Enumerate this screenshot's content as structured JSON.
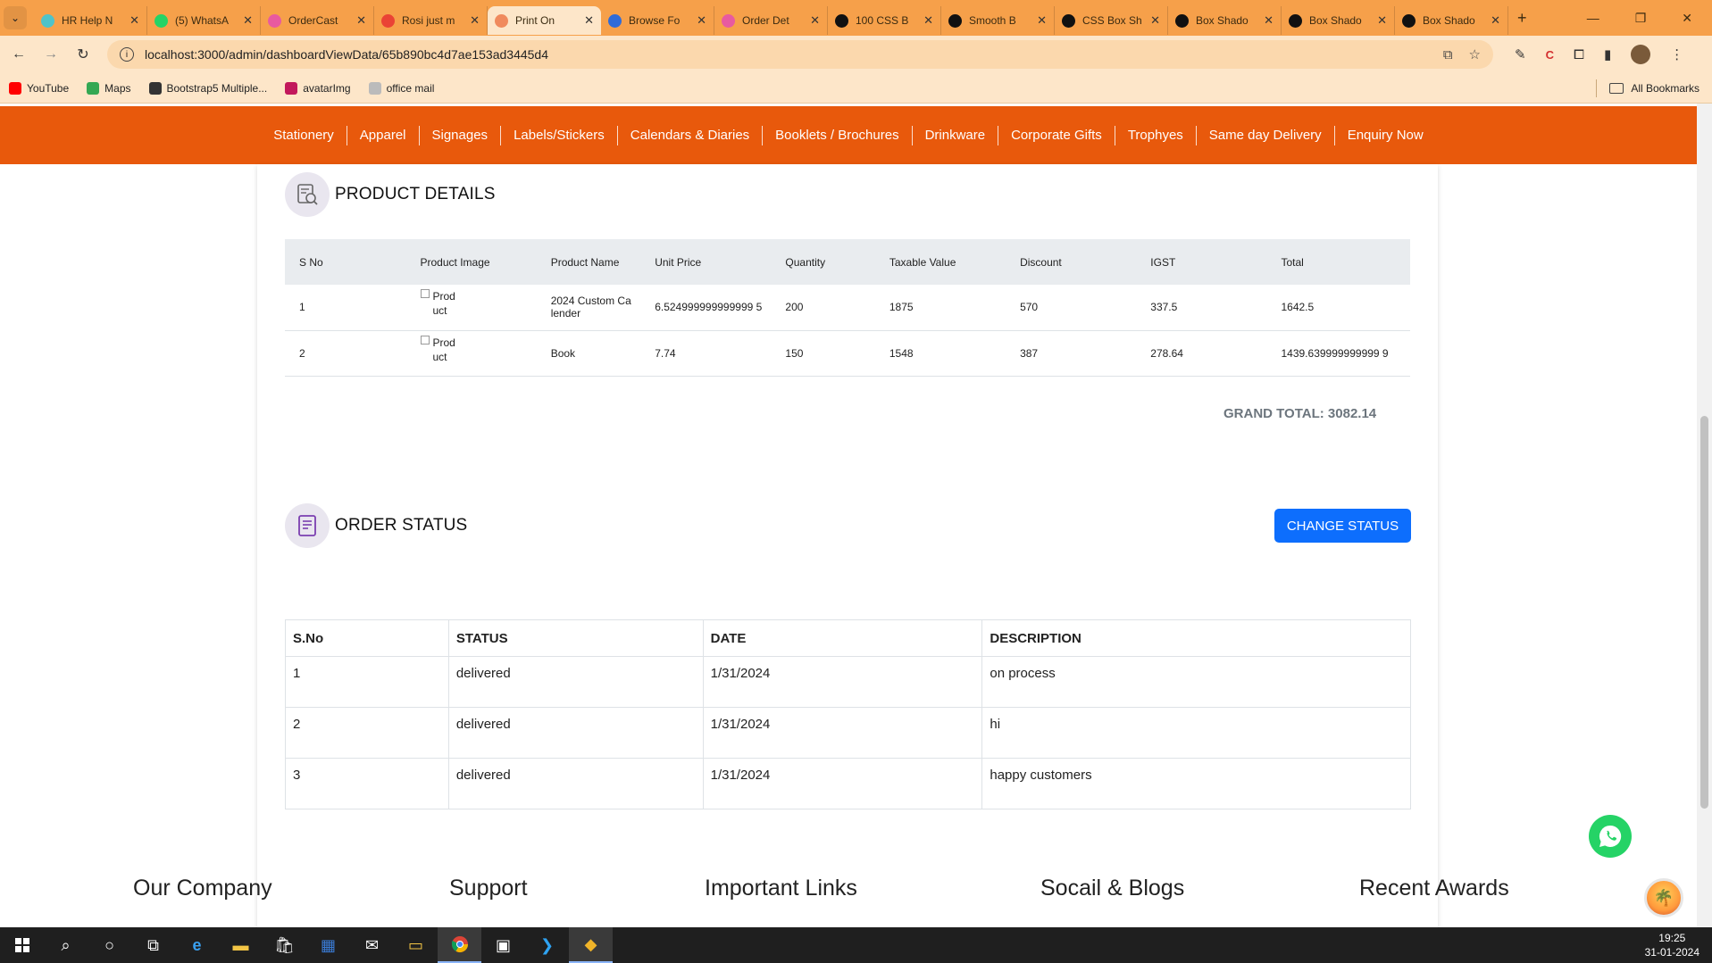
{
  "browser": {
    "tabs": [
      {
        "label": "HR Help N",
        "fav_color": "#4fc3c9",
        "active": false
      },
      {
        "label": "(5) WhatsA",
        "fav_color": "#25d366",
        "active": false
      },
      {
        "label": "OrderCast",
        "fav_color": "#e85aa0",
        "active": false
      },
      {
        "label": "Rosi just m",
        "fav_color": "#ea4335",
        "active": false
      },
      {
        "label": "Print On",
        "fav_color": "#f08a5d",
        "active": true
      },
      {
        "label": "Browse Fo",
        "fav_color": "#2f6bd8",
        "active": false
      },
      {
        "label": "Order Det",
        "fav_color": "#e85aa0",
        "active": false
      },
      {
        "label": "100 CSS B",
        "fav_color": "#111111",
        "active": false
      },
      {
        "label": "Smooth B",
        "fav_color": "#111111",
        "active": false
      },
      {
        "label": "CSS Box Sh",
        "fav_color": "#111111",
        "active": false
      },
      {
        "label": "Box Shado",
        "fav_color": "#111111",
        "active": false
      },
      {
        "label": "Box Shado",
        "fav_color": "#111111",
        "active": false
      },
      {
        "label": "Box Shado",
        "fav_color": "#111111",
        "active": false
      }
    ],
    "url": "localhost:3000/admin/dashboardViewData/65b890bc4d7ae153ad3445d4",
    "bookmarks": [
      {
        "label": "YouTube",
        "color": "#ff0000"
      },
      {
        "label": "Maps",
        "color": "#34a853"
      },
      {
        "label": "Bootstrap5 Multiple...",
        "color": "#333333"
      },
      {
        "label": "avatarImg",
        "color": "#c2185b"
      },
      {
        "label": "office mail",
        "color": "#bbbbbb"
      }
    ],
    "all_bookmarks": "All Bookmarks"
  },
  "site_nav": [
    "Stationery",
    "Apparel",
    "Signages",
    "Labels/Stickers",
    "Calendars & Diaries",
    "Booklets / Brochures",
    "Drinkware",
    "Corporate Gifts",
    "Trophyes",
    "Same day Delivery",
    "Enquiry Now"
  ],
  "product_details": {
    "title": "PRODUCT DETAILS",
    "headers": [
      "S No",
      "Product Image",
      "Product Name",
      "Unit Price",
      "Quantity",
      "Taxable Value",
      "Discount",
      "IGST",
      "Total"
    ],
    "rows": [
      {
        "sno": "1",
        "img_alt": "Product",
        "name": "2024 Custom Calender",
        "unit_price": "6.524999999999999 5",
        "quantity": "200",
        "taxable": "1875",
        "discount": "570",
        "igst": "337.5",
        "total": "1642.5"
      },
      {
        "sno": "2",
        "img_alt": "Product",
        "name": "Book",
        "unit_price": "7.74",
        "quantity": "150",
        "taxable": "1548",
        "discount": "387",
        "igst": "278.64",
        "total": "1439.639999999999 9"
      }
    ],
    "grand_total": "GRAND TOTAL: 3082.14"
  },
  "order_status": {
    "title": "ORDER STATUS",
    "change_button": "CHANGE STATUS",
    "headers": [
      "S.No",
      "STATUS",
      "DATE",
      "DESCRIPTION"
    ],
    "rows": [
      {
        "sno": "1",
        "status": "delivered",
        "date": "1/31/2024",
        "description": "on process"
      },
      {
        "sno": "2",
        "status": "delivered",
        "date": "1/31/2024",
        "description": "hi"
      },
      {
        "sno": "3",
        "status": "delivered",
        "date": "1/31/2024",
        "description": "happy customers"
      }
    ]
  },
  "footer": {
    "headings": [
      "Our Company",
      "Support",
      "Important Links",
      "Socail & Blogs",
      "Recent Awards"
    ]
  },
  "taskbar": {
    "time": "19:25",
    "date": "31-01-2024"
  },
  "colors": {
    "nav_orange": "#e8590c",
    "button_blue": "#0d6efd",
    "whatsapp_green": "#25d366"
  }
}
